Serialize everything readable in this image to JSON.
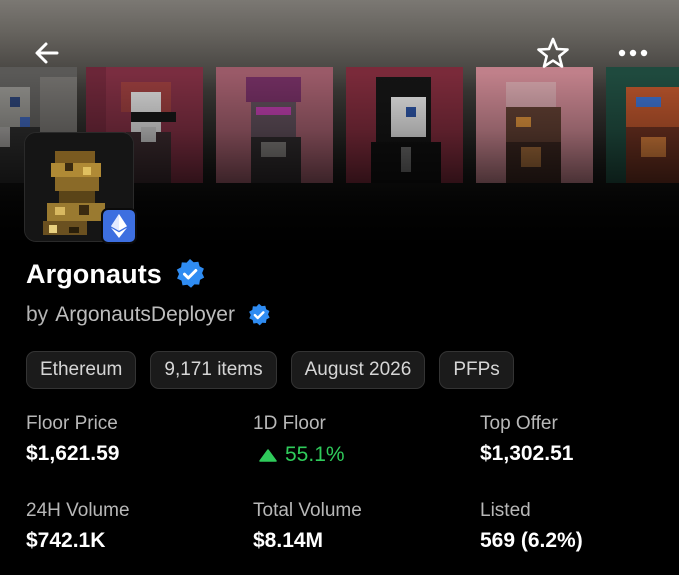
{
  "collection": {
    "name": "Argonauts",
    "creator_prefix": "by",
    "creator_name": "ArgonautsDeployer",
    "chips": [
      "Ethereum",
      "9,171 items",
      "August 2026",
      "PFPs"
    ]
  },
  "stats": [
    {
      "label": "Floor Price",
      "value": "$1,621.59"
    },
    {
      "label": "1D Floor",
      "value": "55.1%",
      "trend": "up"
    },
    {
      "label": "Top Offer",
      "value": "$1,302.51"
    },
    {
      "label": "24H Volume",
      "value": "$742.1K"
    },
    {
      "label": "Total Volume",
      "value": "$8.14M"
    },
    {
      "label": "Listed",
      "value": "569 (6.2%)"
    }
  ],
  "icons": {
    "back": "arrow-left-icon",
    "favorite": "star-outline-icon",
    "more": "more-horizontal-icon",
    "chain": "ethereum-icon",
    "verified": "verified-check-icon",
    "trend": "triangle-up-icon"
  },
  "colors": {
    "background": "#000000",
    "verified": "#2f8cf2",
    "positive": "#2fcb5b",
    "chain_badge": "#3d6fe0",
    "chip_bg": "#1b1b1b",
    "chip_border": "#343434"
  }
}
